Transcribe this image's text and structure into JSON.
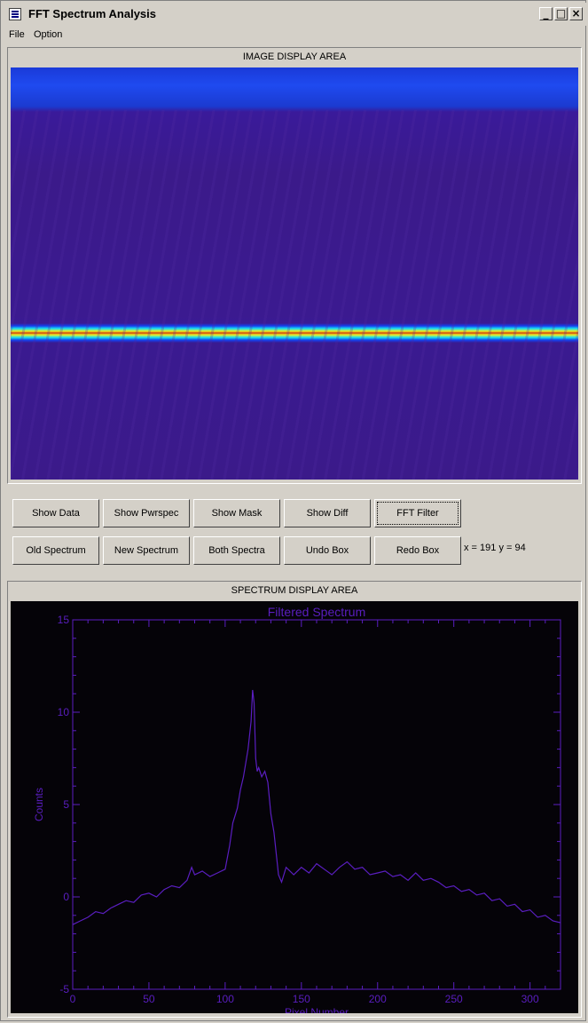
{
  "window": {
    "title": "FFT Spectrum Analysis"
  },
  "menu": {
    "items": [
      "File",
      "Option"
    ]
  },
  "image_panel": {
    "label": "IMAGE DISPLAY AREA"
  },
  "buttons": {
    "row1": [
      "Show Data",
      "Show Pwrspec",
      "Show Mask",
      "Show Diff",
      "FFT Filter"
    ],
    "row2": [
      "Old Spectrum",
      "New Spectrum",
      "Both Spectra",
      "Undo Box",
      "Redo Box"
    ]
  },
  "cursor_readout": "x = 191  y =  94",
  "spectrum_panel": {
    "label": "SPECTRUM DISPLAY AREA"
  },
  "chart_data": {
    "type": "line",
    "title": "Filtered  Spectrum",
    "xlabel": "Pixel Number",
    "ylabel": "Counts",
    "xlim": [
      0,
      320
    ],
    "ylim": [
      -5,
      15
    ],
    "xticks": [
      0,
      50,
      100,
      150,
      200,
      250,
      300
    ],
    "yticks": [
      -5,
      0,
      5,
      10,
      15
    ],
    "color": "#5a1ec0",
    "series": [
      {
        "x": [
          0,
          5,
          10,
          15,
          20,
          25,
          30,
          35,
          40,
          45,
          50,
          55,
          60,
          65,
          70,
          75,
          78,
          80,
          85,
          90,
          95,
          100,
          103,
          105,
          108,
          110,
          112,
          115,
          117,
          118,
          119,
          120,
          121,
          122,
          124,
          126,
          128,
          130,
          132,
          135,
          137,
          140,
          145,
          150,
          155,
          160,
          165,
          170,
          175,
          180,
          185,
          190,
          195,
          200,
          205,
          210,
          215,
          220,
          225,
          230,
          235,
          240,
          245,
          250,
          255,
          260,
          265,
          270,
          275,
          280,
          285,
          290,
          295,
          300,
          305,
          310,
          315,
          320
        ],
        "y": [
          -1.5,
          -1.3,
          -1.1,
          -0.8,
          -0.9,
          -0.6,
          -0.4,
          -0.2,
          -0.3,
          0.1,
          0.2,
          0.0,
          0.4,
          0.6,
          0.5,
          0.9,
          1.6,
          1.2,
          1.4,
          1.1,
          1.3,
          1.5,
          2.8,
          4.0,
          4.8,
          5.8,
          6.5,
          8.0,
          9.5,
          11.2,
          10.5,
          7.5,
          6.8,
          7.0,
          6.5,
          6.8,
          6.2,
          4.5,
          3.5,
          1.2,
          0.8,
          1.6,
          1.2,
          1.6,
          1.3,
          1.8,
          1.5,
          1.2,
          1.6,
          1.9,
          1.5,
          1.6,
          1.2,
          1.3,
          1.4,
          1.1,
          1.2,
          0.9,
          1.3,
          0.9,
          1.0,
          0.8,
          0.5,
          0.6,
          0.3,
          0.4,
          0.1,
          0.2,
          -0.2,
          -0.1,
          -0.5,
          -0.4,
          -0.8,
          -0.7,
          -1.1,
          -1.0,
          -1.3,
          -1.4
        ]
      }
    ]
  }
}
